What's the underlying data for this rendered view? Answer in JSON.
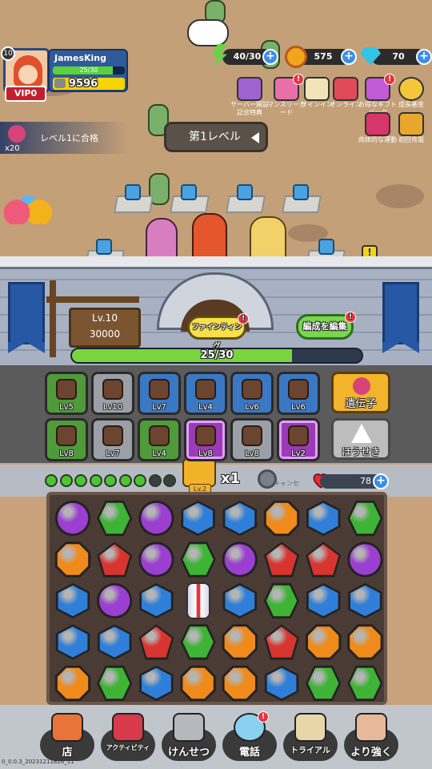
{
  "player": {
    "level": "10",
    "name": "JamesKing",
    "exp": "25/30",
    "power": "9596",
    "vip": "VIP0"
  },
  "resources": {
    "energy": "40/30",
    "coins": "575",
    "diamonds": "70"
  },
  "features": {
    "server_launch": "サーバー開設記念特典",
    "monthly_card": "マンスリーカード",
    "sign_in": "サインイン",
    "online": "オンライン",
    "gift_pack": "お得なギフトパック",
    "growth_fund": "成長基金",
    "physical_exercise": "肉体的な運動",
    "first_recharge": "初回充電"
  },
  "quest": {
    "text": "レベル1に合格",
    "count": "x20"
  },
  "level_label": "第1レベル",
  "wall": {
    "level": "Lv.10",
    "hp_max": "30000",
    "hp": "25/30"
  },
  "buttons": {
    "fighting": "ファインティング",
    "edit_team": "編成を編集",
    "gene": "遺伝子",
    "gem": "ほうせき"
  },
  "equipment": [
    {
      "label": "Lv5",
      "tier": "g"
    },
    {
      "label": "Lv10",
      "tier": "s"
    },
    {
      "label": "Lv7",
      "tier": "b"
    },
    {
      "label": "Lv4",
      "tier": "b"
    },
    {
      "label": "Lv6",
      "tier": "b"
    },
    {
      "label": "Lv6",
      "tier": "b"
    },
    {
      "label": "Lv8",
      "tier": "g"
    },
    {
      "label": "Lv7",
      "tier": "s"
    },
    {
      "label": "Lv4",
      "tier": "g"
    },
    {
      "label": "Lv8",
      "tier": "p"
    },
    {
      "label": "Lv8",
      "tier": "s"
    },
    {
      "label": "Lv2",
      "tier": "p"
    }
  ],
  "status": {
    "combo_total": 9,
    "combo_filled": 7,
    "chest_level": "Lv.2",
    "multiplier": "x1",
    "skip_label": "キャンセ",
    "hp": "78"
  },
  "board": [
    [
      "purple",
      "green",
      "purple",
      "blue",
      "blue",
      "orange",
      "blue",
      "green"
    ],
    [
      "orange",
      "red",
      "purple",
      "green",
      "purple",
      "red",
      "red",
      "purple"
    ],
    [
      "blue",
      "purple",
      "blue",
      "special",
      "blue",
      "green",
      "blue",
      "blue"
    ],
    [
      "blue",
      "blue",
      "red",
      "green",
      "orange",
      "red",
      "orange",
      "orange"
    ],
    [
      "orange",
      "green",
      "blue",
      "orange",
      "orange",
      "blue",
      "green",
      "green"
    ]
  ],
  "gem_colors": {
    "purple": "#9a3fd0",
    "green": "#3fb336",
    "blue": "#2f7fd8",
    "orange": "#f08a1a",
    "red": "#d83530"
  },
  "nav": {
    "shop": "店",
    "activity": "アクティビティ",
    "build": "けんせつ",
    "phone": "電話",
    "trial": "トライアル",
    "stronger": "より強く"
  },
  "version": "0_0.0.3_20231211826_11"
}
